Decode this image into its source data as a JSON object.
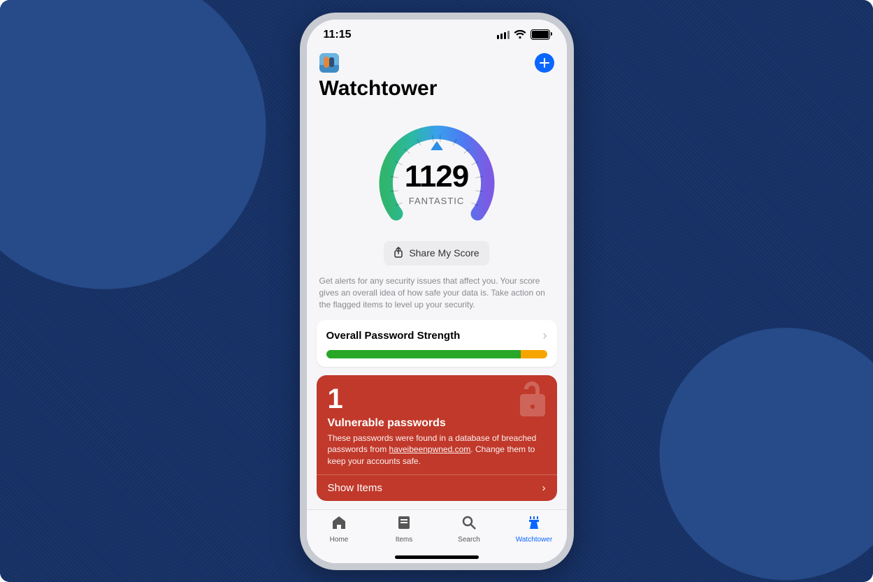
{
  "status": {
    "time": "11:15"
  },
  "header": {
    "title": "Watchtower"
  },
  "gauge": {
    "score": "1129",
    "rating": "FANTASTIC"
  },
  "share_button": {
    "label": "Share My Score"
  },
  "description": "Get alerts for any security issues that affect you. Your score gives an overall idea of how safe your data is. Take action on the flagged items to level up your security.",
  "strength_card": {
    "title": "Overall Password Strength",
    "green_pct": 88,
    "yellow_pct": 12
  },
  "alert_card": {
    "count": "1",
    "title": "Vulnerable passwords",
    "text_prefix": "These passwords were found in a database of breached passwords from ",
    "link": "haveibeenpwned.com",
    "text_suffix": ". Change them to keep your accounts safe.",
    "action": "Show Items"
  },
  "tabs": {
    "home": {
      "label": "Home"
    },
    "items": {
      "label": "Items"
    },
    "search": {
      "label": "Search"
    },
    "watch": {
      "label": "Watchtower"
    }
  }
}
